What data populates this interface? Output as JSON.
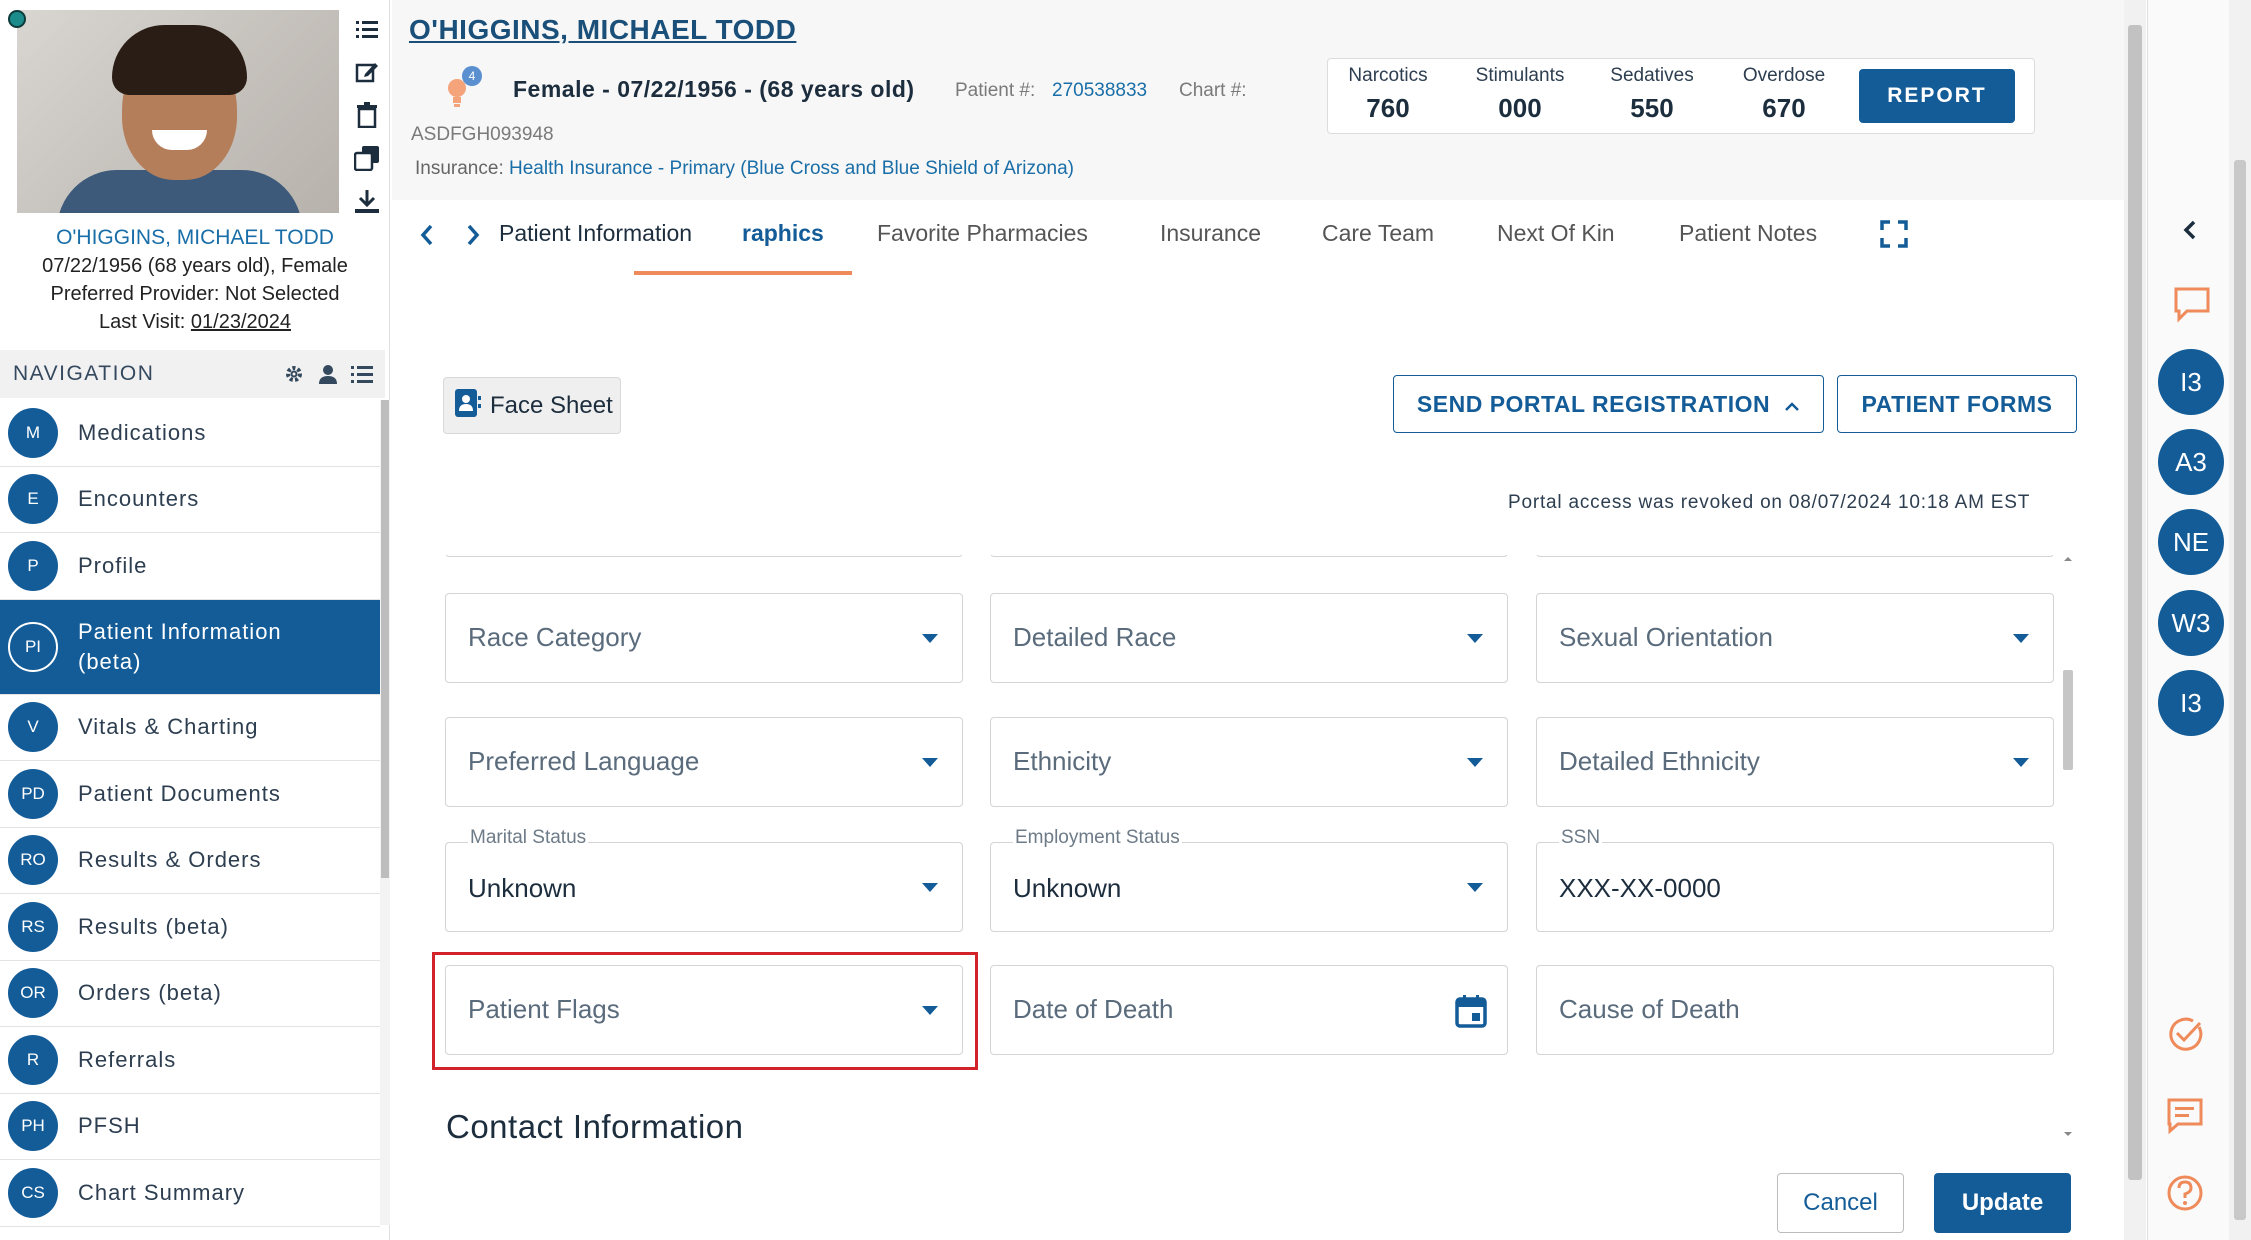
{
  "patient": {
    "name": "O'HIGGINS, MICHAEL TODD",
    "summary_name": "O'HIGGINS, MICHAEL TODD",
    "dob_line": "07/22/1956 (68 years old), Female",
    "preferred_provider": "Preferred Provider: Not Selected",
    "last_visit_label": "Last Visit:",
    "last_visit_date": "01/23/2024",
    "demographics": "Female - 07/22/1956 - (68 years old)",
    "patient_number_label": "Patient #:",
    "patient_number": "270538833",
    "chart_label": "Chart #:",
    "chart_number": "ASDFGH093948",
    "insurance_label": "Insurance:",
    "insurance_value": "Health Insurance - Primary (Blue Cross and Blue Shield of Arizona)",
    "flag_count": "4"
  },
  "counts": [
    {
      "label": "Narcotics",
      "value": "760"
    },
    {
      "label": "Stimulants",
      "value": "000"
    },
    {
      "label": "Sedatives",
      "value": "550"
    },
    {
      "label": "Overdose",
      "value": "670"
    }
  ],
  "report_label": "REPORT",
  "navigation": {
    "title": "NAVIGATION",
    "items": [
      {
        "badge": "M",
        "label": "Medications"
      },
      {
        "badge": "E",
        "label": "Encounters"
      },
      {
        "badge": "P",
        "label": "Profile"
      },
      {
        "badge": "PI",
        "label": "Patient Information (beta)"
      },
      {
        "badge": "V",
        "label": "Vitals & Charting"
      },
      {
        "badge": "PD",
        "label": "Patient Documents"
      },
      {
        "badge": "RO",
        "label": "Results & Orders"
      },
      {
        "badge": "RS",
        "label": "Results (beta)"
      },
      {
        "badge": "OR",
        "label": "Orders (beta)"
      },
      {
        "badge": "R",
        "label": "Referrals"
      },
      {
        "badge": "PH",
        "label": "PFSH"
      },
      {
        "badge": "CS",
        "label": "Chart Summary"
      }
    ]
  },
  "tabs": {
    "items": [
      "Patient Information",
      "raphics",
      "Favorite Pharmacies",
      "Insurance",
      "Care Team",
      "Next Of Kin",
      "Patient Notes"
    ]
  },
  "actions": {
    "face_sheet": "Face Sheet",
    "send_portal": "SEND PORTAL REGISTRATION",
    "patient_forms": "PATIENT FORMS",
    "portal_message": "Portal access was revoked on 08/07/2024 10:18 AM EST",
    "cancel": "Cancel",
    "update": "Update"
  },
  "form": {
    "race_category": "Race Category",
    "detailed_race": "Detailed Race",
    "sexual_orientation": "Sexual Orientation",
    "preferred_language": "Preferred Language",
    "ethnicity": "Ethnicity",
    "detailed_ethnicity": "Detailed Ethnicity",
    "marital_status_label": "Marital Status",
    "marital_status_value": "Unknown",
    "employment_status_label": "Employment Status",
    "employment_status_value": "Unknown",
    "ssn_label": "SSN",
    "ssn_value": "XXX-XX-0000",
    "patient_flags": "Patient Flags",
    "date_of_death": "Date of Death",
    "cause_of_death": "Cause of Death",
    "contact_section": "Contact Information"
  },
  "right_rail": {
    "avatars": [
      "I3",
      "A3",
      "NE",
      "W3",
      "I3"
    ]
  },
  "colors": {
    "primary": "#135c98",
    "accent_orange": "#ef8a5a",
    "highlight_red": "#d2232a"
  }
}
